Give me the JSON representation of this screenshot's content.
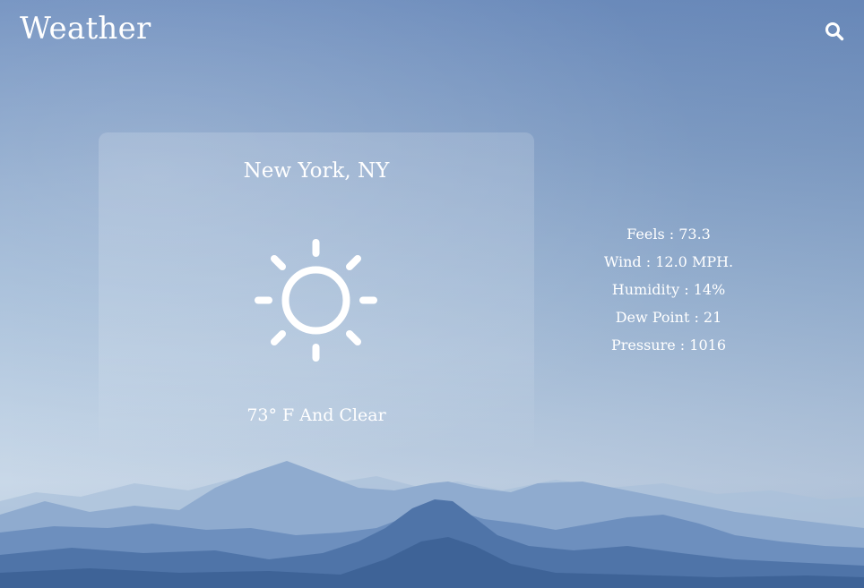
{
  "header": {
    "title": "Weather",
    "search_icon": "search-icon"
  },
  "current": {
    "location": "New York, NY",
    "icon": "sun-icon",
    "condition": "73° F And Clear"
  },
  "details": [
    {
      "label": "Feels",
      "value": "73.3",
      "text": "Feels : 73.3"
    },
    {
      "label": "Wind",
      "value": "12.0 MPH.",
      "text": "Wind : 12.0 MPH."
    },
    {
      "label": "Humidity",
      "value": "14%",
      "text": "Humidity : 14%"
    },
    {
      "label": "Dew Point",
      "value": "21",
      "text": "Dew Point : 21"
    },
    {
      "label": "Pressure",
      "value": "1016",
      "text": "Pressure : 1016"
    }
  ],
  "colors": {
    "sky_top": "#6f8fbf",
    "sky_bottom": "#c9d8e8",
    "text": "#ffffff"
  }
}
